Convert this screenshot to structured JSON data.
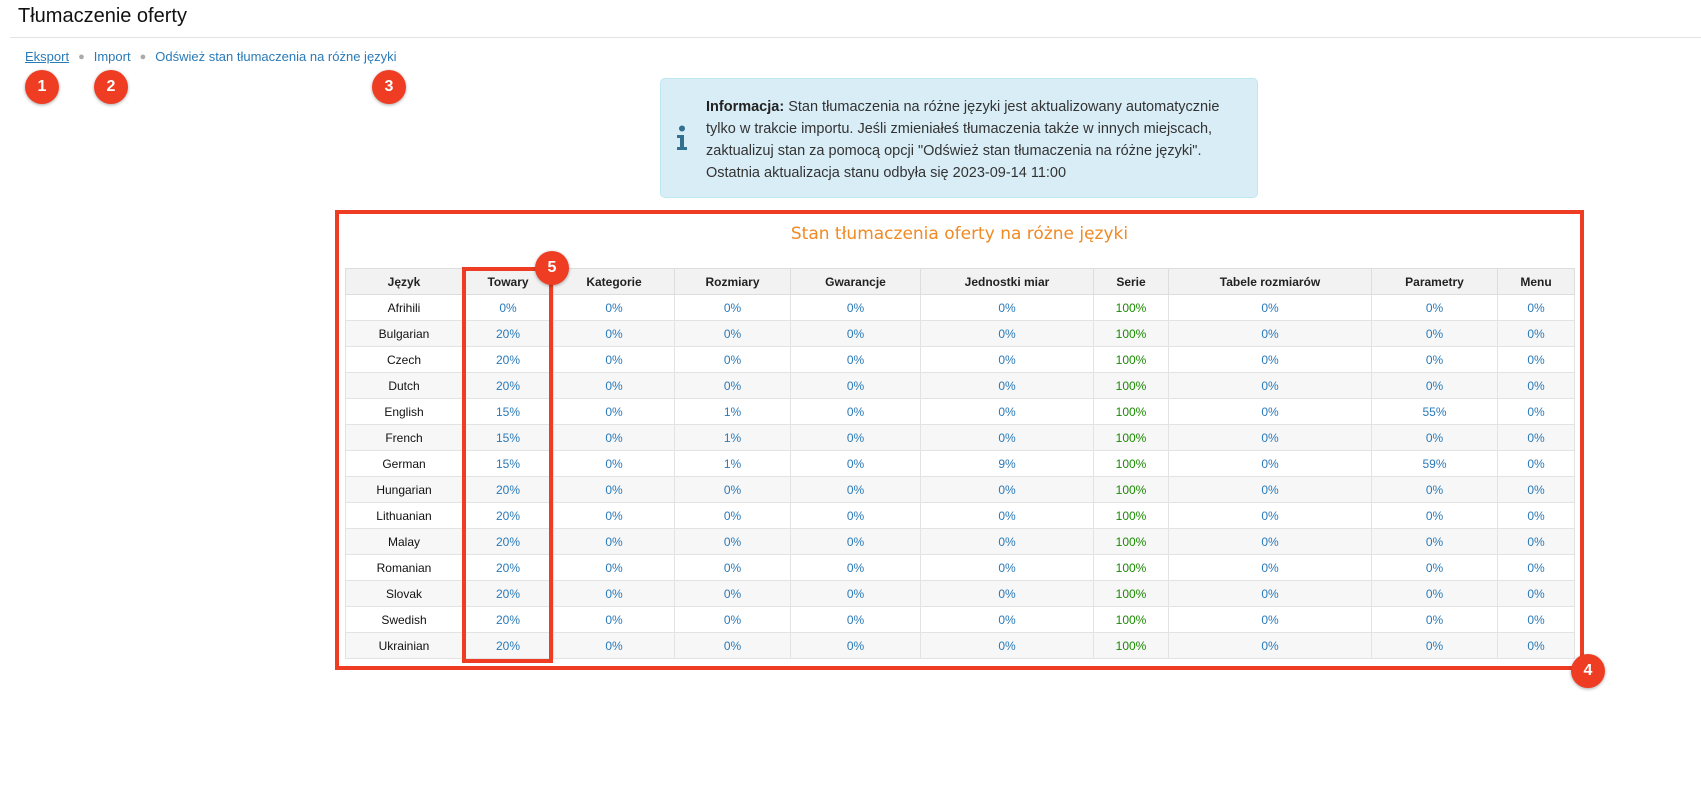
{
  "page": {
    "title": "Tłumaczenie oferty"
  },
  "actions": {
    "export": "Eksport",
    "import": "Import",
    "refresh": "Odśwież stan tłumaczenia na różne języki"
  },
  "badges": [
    "1",
    "2",
    "3",
    "4",
    "5"
  ],
  "info": {
    "label": "Informacja:",
    "text": " Stan tłumaczenia na różne języki jest aktualizowany automatycznie tylko w trakcie importu. Jeśli zmieniałeś tłumaczenia także w innych miejscach, zaktualizuj stan za pomocą opcji \"Odśwież stan tłumaczenia na różne języki\". Ostatnia aktualizacja stanu odbyła się 2023-09-14 11:00",
    "icon": "info-icon"
  },
  "table": {
    "title": "Stan tłumaczenia oferty na różne języki",
    "headers": [
      "Język",
      "Towary",
      "Kategorie",
      "Rozmiary",
      "Gwarancje",
      "Jednostki miar",
      "Serie",
      "Tabele rozmiarów",
      "Parametry",
      "Menu"
    ],
    "rows": [
      [
        "Afrihili",
        "0%",
        "0%",
        "0%",
        "0%",
        "0%",
        "100%",
        "0%",
        "0%",
        "0%"
      ],
      [
        "Bulgarian",
        "20%",
        "0%",
        "0%",
        "0%",
        "0%",
        "100%",
        "0%",
        "0%",
        "0%"
      ],
      [
        "Czech",
        "20%",
        "0%",
        "0%",
        "0%",
        "0%",
        "100%",
        "0%",
        "0%",
        "0%"
      ],
      [
        "Dutch",
        "20%",
        "0%",
        "0%",
        "0%",
        "0%",
        "100%",
        "0%",
        "0%",
        "0%"
      ],
      [
        "English",
        "15%",
        "0%",
        "1%",
        "0%",
        "0%",
        "100%",
        "0%",
        "55%",
        "0%"
      ],
      [
        "French",
        "15%",
        "0%",
        "1%",
        "0%",
        "0%",
        "100%",
        "0%",
        "0%",
        "0%"
      ],
      [
        "German",
        "15%",
        "0%",
        "1%",
        "0%",
        "9%",
        "100%",
        "0%",
        "59%",
        "0%"
      ],
      [
        "Hungarian",
        "20%",
        "0%",
        "0%",
        "0%",
        "0%",
        "100%",
        "0%",
        "0%",
        "0%"
      ],
      [
        "Lithuanian",
        "20%",
        "0%",
        "0%",
        "0%",
        "0%",
        "100%",
        "0%",
        "0%",
        "0%"
      ],
      [
        "Malay",
        "20%",
        "0%",
        "0%",
        "0%",
        "0%",
        "100%",
        "0%",
        "0%",
        "0%"
      ],
      [
        "Romanian",
        "20%",
        "0%",
        "0%",
        "0%",
        "0%",
        "100%",
        "0%",
        "0%",
        "0%"
      ],
      [
        "Slovak",
        "20%",
        "0%",
        "0%",
        "0%",
        "0%",
        "100%",
        "0%",
        "0%",
        "0%"
      ],
      [
        "Swedish",
        "20%",
        "0%",
        "0%",
        "0%",
        "0%",
        "100%",
        "0%",
        "0%",
        "0%"
      ],
      [
        "Ukrainian",
        "20%",
        "0%",
        "0%",
        "0%",
        "0%",
        "100%",
        "0%",
        "0%",
        "0%"
      ]
    ]
  },
  "colors": {
    "link": "#2a7ab8",
    "complete": "#1a8a00",
    "title_accent": "#f08a24",
    "annotation": "#ee3d23",
    "info_bg": "#d9edf7"
  }
}
